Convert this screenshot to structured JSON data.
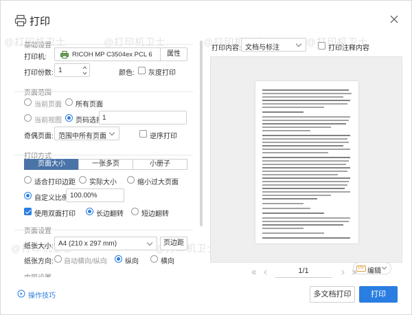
{
  "window": {
    "title": "打印"
  },
  "watermarks": [
    "@打印机卫士",
    "@打印机卫士",
    "@打印机卫士",
    "@打印机卫士",
    "@打印机卫士",
    "@打印机卫士"
  ],
  "basic": {
    "section_title": "基础设置",
    "printer_label": "打印机:",
    "printer_value": "RICOH MP C3504ex PCL 6",
    "properties_button": "属性",
    "copies_label": "打印份数:",
    "copies_value": "1",
    "color_label": "颜色:",
    "grayscale_label": "灰度打印"
  },
  "range": {
    "section_title": "页面范围",
    "current_page": "当前页面",
    "all_pages": "所有页面",
    "current_view": "当前视图",
    "page_select": "页码选择:",
    "page_select_value": "1",
    "odd_even_label": "奇偶页面:",
    "odd_even_value": "范围中所有页面",
    "reverse_label": "逆序打印"
  },
  "mode": {
    "section_title": "打印方式",
    "tabs": [
      "页面大小",
      "一张多页",
      "小册子"
    ],
    "fit_margin": "适合打印边距",
    "actual_size": "实际大小",
    "shrink_large": "缩小过大页面",
    "custom_scale": "自定义比例",
    "scale_value": "100.00%",
    "duplex_label": "使用双面打印",
    "long_edge": "长边翻转",
    "short_edge": "短边翻转"
  },
  "page_setup": {
    "section_title": "页面设置",
    "paper_size_label": "纸张大小:",
    "paper_size_value": "A4 (210 x 297 mm)",
    "margins_button": "页边距",
    "orientation_label": "纸张方向:",
    "auto_orientation": "自动横向/纵向",
    "portrait": "纵向",
    "landscape": "横向"
  },
  "content_setup": {
    "section_title": "内容设置"
  },
  "right": {
    "print_content_label": "打印内容:",
    "print_content_value": "文档与标注",
    "annotation_label": "打印注释内容",
    "edit_button": "编辑",
    "vip_badge": "VIP",
    "page_indicator": "1/1"
  },
  "footer": {
    "tips_label": "操作技巧",
    "multi_doc_button": "多文档打印",
    "print_button": "打印"
  },
  "colors": {
    "accent": "#2a7de1",
    "tab_active": "#4a74a8"
  }
}
